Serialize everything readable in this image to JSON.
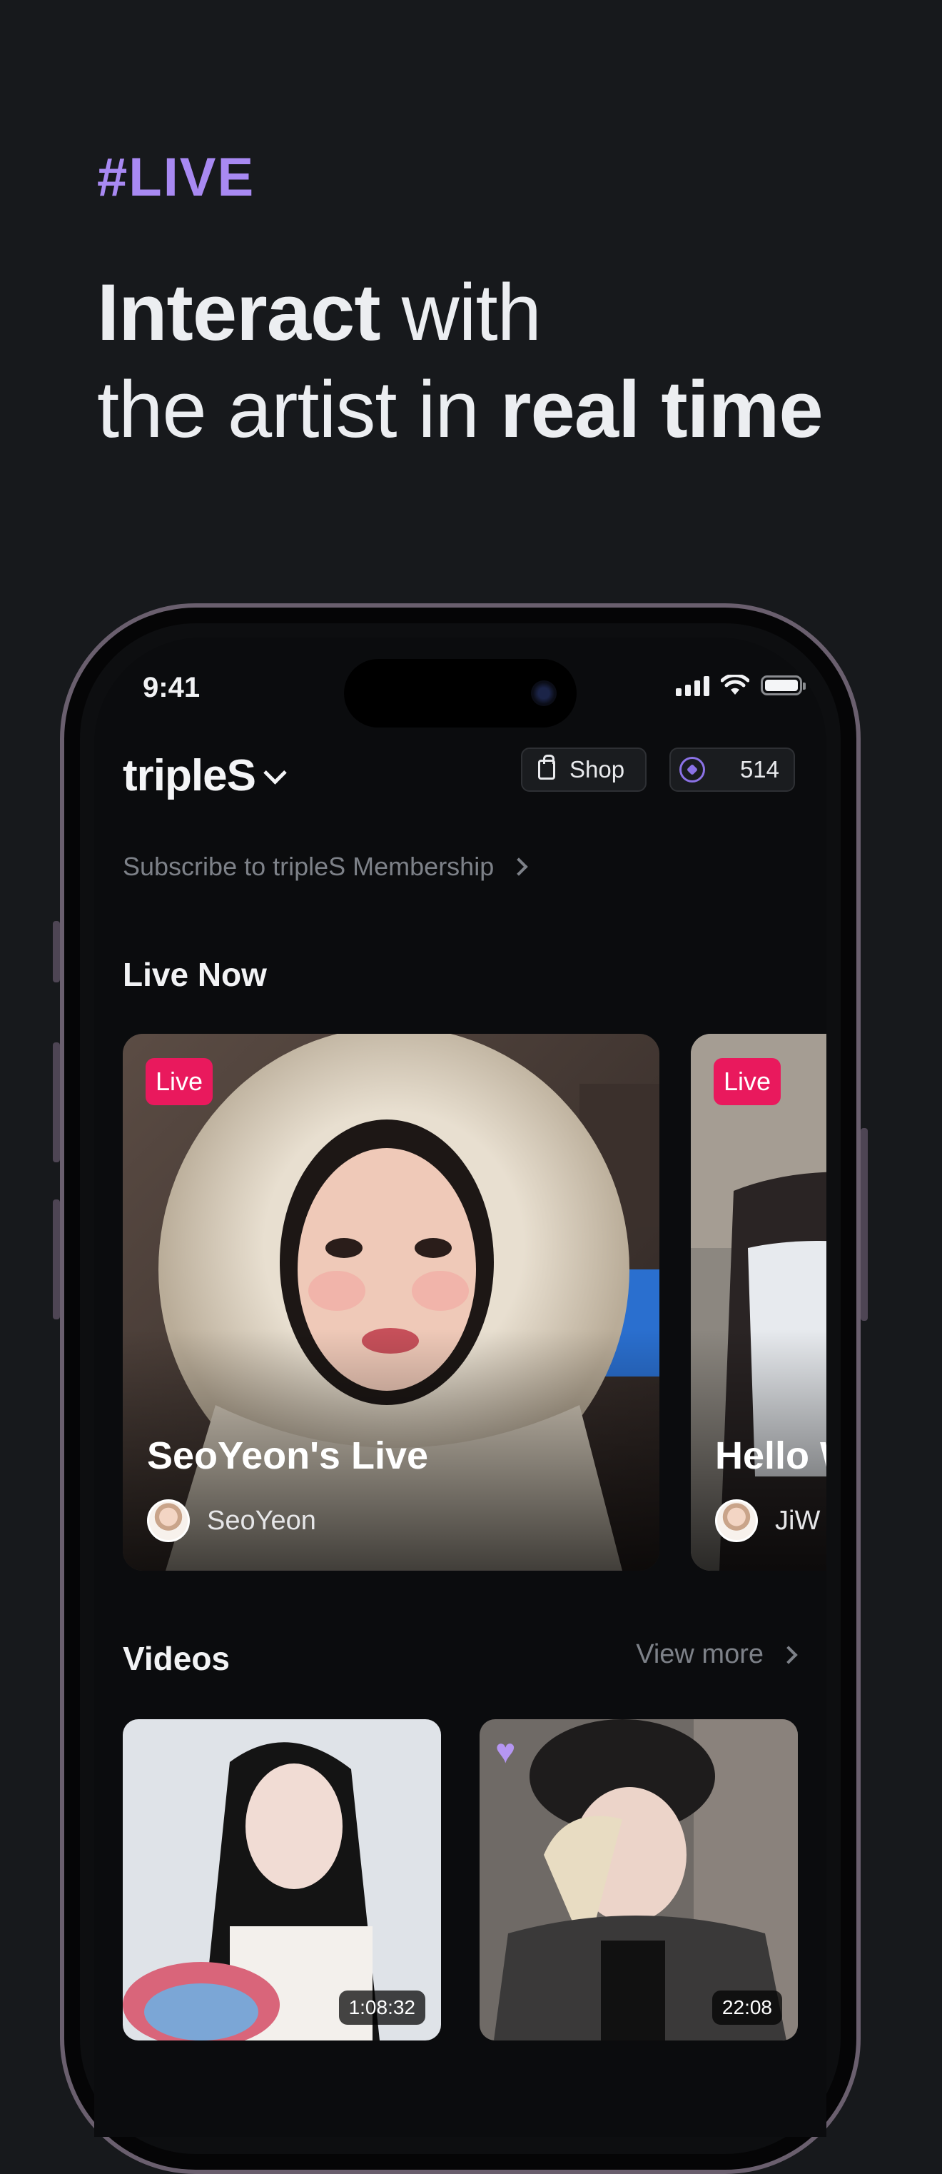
{
  "hero": {
    "tag": "#LIVE",
    "line1_bold": "Interact",
    "line1_rest": " with",
    "line2_rest": "the artist in ",
    "line2_bold": "real time"
  },
  "status_bar": {
    "time": "9:41"
  },
  "header": {
    "brand": "tripleS",
    "shop_label": "Shop",
    "coin_count": "514"
  },
  "subscribe_text": "Subscribe to tripleS Membership",
  "live_now": {
    "title": "Live Now",
    "cards": [
      {
        "badge": "Live",
        "title": "SeoYeon's Live",
        "author": "SeoYeon"
      },
      {
        "badge": "Live",
        "title": "Hello W",
        "author": "JiW"
      }
    ]
  },
  "videos": {
    "title": "Videos",
    "view_more": "View more",
    "items": [
      {
        "duration": "1:08:32"
      },
      {
        "duration": "22:08"
      }
    ]
  },
  "colors": {
    "accent_purple": "#a889f2",
    "live_badge": "#e9195d",
    "background": "#17191c"
  }
}
